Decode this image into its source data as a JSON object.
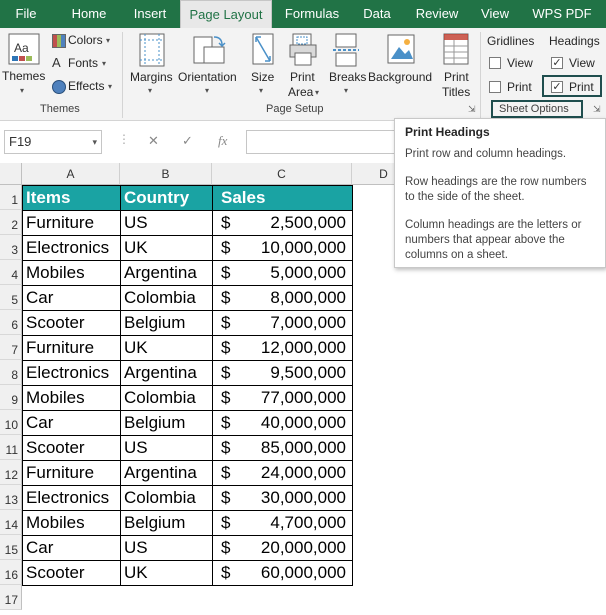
{
  "tabs": [
    {
      "label": "File",
      "active": false
    },
    {
      "label": "Home",
      "active": false
    },
    {
      "label": "Insert",
      "active": false
    },
    {
      "label": "Page Layout",
      "active": true
    },
    {
      "label": "Formulas",
      "active": false
    },
    {
      "label": "Data",
      "active": false
    },
    {
      "label": "Review",
      "active": false
    },
    {
      "label": "View",
      "active": false
    },
    {
      "label": "WPS PDF",
      "active": false
    }
  ],
  "ribbon": {
    "themes": {
      "themes_label": "Themes",
      "colors_label": "Colors",
      "fonts_label": "Fonts",
      "effects_label": "Effects",
      "group_label": "Themes"
    },
    "page_setup": {
      "margins_label": "Margins",
      "orientation_label": "Orientation",
      "size_label": "Size",
      "print_area_line1": "Print",
      "print_area_line2": "Area",
      "breaks_label": "Breaks",
      "background_label": "Background",
      "print_titles_line1": "Print",
      "print_titles_line2": "Titles",
      "group_label": "Page Setup"
    },
    "sheet_options": {
      "gridlines_label": "Gridlines",
      "headings_label": "Headings",
      "gridlines_view_label": "View",
      "gridlines_print_label": "Print",
      "headings_view_label": "View",
      "headings_print_label": "Print",
      "gridlines_view_checked": false,
      "gridlines_print_checked": false,
      "headings_view_checked": true,
      "headings_print_checked": true,
      "group_label": "Sheet Options"
    }
  },
  "formula_bar": {
    "name_box": "F19",
    "cancel_symbol": "✕",
    "enter_symbol": "✓",
    "fx_symbol": "fx",
    "formula_value": ""
  },
  "columns": [
    "A",
    "B",
    "C",
    "D"
  ],
  "rows": [
    "1",
    "2",
    "3",
    "4",
    "5",
    "6",
    "7",
    "8",
    "9",
    "10",
    "11",
    "12",
    "13",
    "14",
    "15",
    "16",
    "17"
  ],
  "table": {
    "headers": [
      "Items",
      "Country",
      "Sales"
    ],
    "currency_symbol": "$",
    "data": [
      {
        "item": "Furniture",
        "country": "US",
        "sales": "2,500,000"
      },
      {
        "item": "Electronics",
        "country": "UK",
        "sales": "10,000,000"
      },
      {
        "item": "Mobiles",
        "country": "Argentina",
        "sales": "5,000,000"
      },
      {
        "item": "Car",
        "country": "Colombia",
        "sales": "8,000,000"
      },
      {
        "item": "Scooter",
        "country": "Belgium",
        "sales": "7,000,000"
      },
      {
        "item": "Furniture",
        "country": "UK",
        "sales": "12,000,000"
      },
      {
        "item": "Electronics",
        "country": "Argentina",
        "sales": "9,500,000"
      },
      {
        "item": "Mobiles",
        "country": "Colombia",
        "sales": "77,000,000"
      },
      {
        "item": "Car",
        "country": "Belgium",
        "sales": "40,000,000"
      },
      {
        "item": "Scooter",
        "country": "US",
        "sales": "85,000,000"
      },
      {
        "item": "Furniture",
        "country": "Argentina",
        "sales": "24,000,000"
      },
      {
        "item": "Electronics",
        "country": "Colombia",
        "sales": "30,000,000"
      },
      {
        "item": "Mobiles",
        "country": "Belgium",
        "sales": "4,700,000"
      },
      {
        "item": "Car",
        "country": "US",
        "sales": "20,000,000"
      },
      {
        "item": "Scooter",
        "country": "UK",
        "sales": "60,000,000"
      }
    ]
  },
  "tooltip": {
    "title": "Print Headings",
    "p1": "Print row and column headings.",
    "p2": "Row headings are the row numbers to the side of the sheet.",
    "p3": "Column headings are the letters or numbers that appear above the columns on a sheet."
  },
  "colors": {
    "ribbon_green": "#217346",
    "table_header": "#1aa3a3",
    "highlight_box": "#1f4e4e"
  }
}
